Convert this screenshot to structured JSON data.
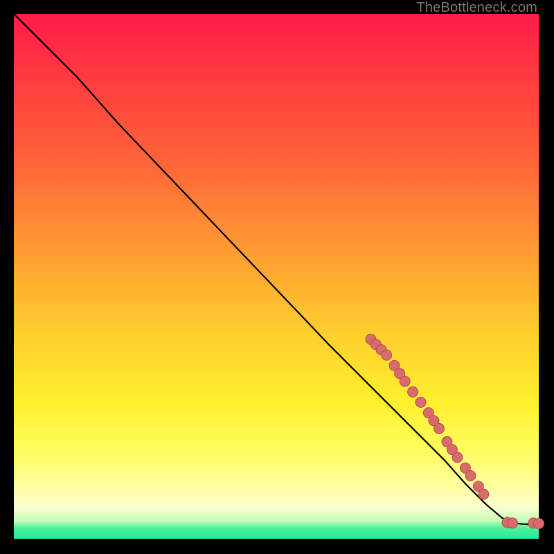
{
  "attribution": "TheBottleneck.com",
  "colors": {
    "marker": "#d86c6c",
    "marker_stroke": "#b64f4f",
    "line": "#000000",
    "gradient_top": "#ff1c49",
    "gradient_bottom": "#2de8a0"
  },
  "chart_data": {
    "type": "line",
    "title": "",
    "xlabel": "",
    "ylabel": "",
    "xlim": [
      0,
      100
    ],
    "ylim": [
      0,
      100
    ],
    "grid": false,
    "legend": false,
    "series": [
      {
        "name": "bottleneck-curve",
        "x": [
          0,
          3,
          7,
          12,
          20,
          30,
          40,
          50,
          60,
          68,
          76,
          82,
          86,
          90,
          93,
          95,
          97,
          99,
          100
        ],
        "y": [
          100,
          97,
          93,
          88,
          79,
          68.5,
          58,
          47.5,
          37,
          29,
          21,
          15,
          10.5,
          6.5,
          4,
          3,
          2.8,
          2.7,
          2.7
        ]
      }
    ],
    "markers": [
      {
        "x": 68,
        "y": 38
      },
      {
        "x": 69,
        "y": 37
      },
      {
        "x": 70,
        "y": 36
      },
      {
        "x": 71,
        "y": 35
      },
      {
        "x": 72.5,
        "y": 33
      },
      {
        "x": 73.5,
        "y": 31.5
      },
      {
        "x": 74.5,
        "y": 30
      },
      {
        "x": 76,
        "y": 28
      },
      {
        "x": 77.5,
        "y": 26
      },
      {
        "x": 79,
        "y": 24
      },
      {
        "x": 80,
        "y": 22.5
      },
      {
        "x": 81,
        "y": 21
      },
      {
        "x": 82.5,
        "y": 18.5
      },
      {
        "x": 83.5,
        "y": 17
      },
      {
        "x": 84.5,
        "y": 15.5
      },
      {
        "x": 86,
        "y": 13.5
      },
      {
        "x": 87,
        "y": 12
      },
      {
        "x": 88.5,
        "y": 10
      },
      {
        "x": 89.5,
        "y": 8.5
      },
      {
        "x": 94,
        "y": 3.1
      },
      {
        "x": 95,
        "y": 3.0
      },
      {
        "x": 99,
        "y": 3.0
      },
      {
        "x": 100,
        "y": 2.9
      }
    ]
  }
}
